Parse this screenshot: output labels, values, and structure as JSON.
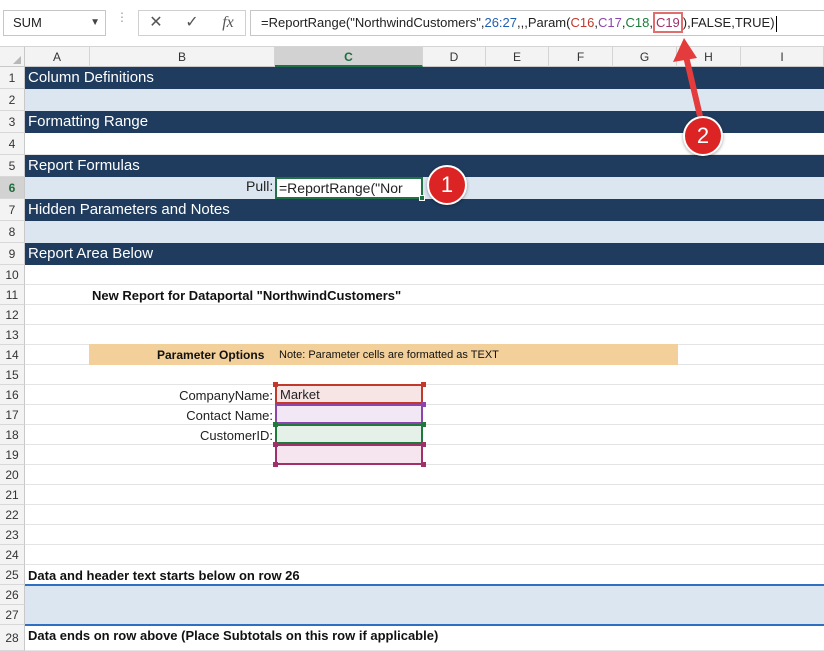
{
  "formula_bar": {
    "name_box": "SUM",
    "cancel_icon": "✕",
    "enter_icon": "✓",
    "fx_label": "fx",
    "formula_parts": [
      {
        "text": "=ReportRange(\"NorthwindCustomers\",",
        "color": "default"
      },
      {
        "text": "26:27",
        "color": "blue"
      },
      {
        "text": ",,,Param(",
        "color": "default"
      },
      {
        "text": "C16",
        "color": "red"
      },
      {
        "text": ",",
        "color": "default"
      },
      {
        "text": "C17",
        "color": "purple"
      },
      {
        "text": ",",
        "color": "default"
      },
      {
        "text": "C18",
        "color": "green"
      },
      {
        "text": ",",
        "color": "default"
      },
      {
        "text": "C19",
        "color": "magenta",
        "boxed": true
      },
      {
        "text": "),FALSE,TRUE)",
        "color": "default"
      }
    ]
  },
  "columns": {
    "labels": [
      "A",
      "B",
      "C",
      "D",
      "E",
      "F",
      "G",
      "H",
      "I"
    ],
    "selected": "C"
  },
  "rows": {
    "labels": [
      "1",
      "2",
      "3",
      "4",
      "5",
      "6",
      "7",
      "8",
      "9",
      "10",
      "11",
      "12",
      "13",
      "14",
      "15",
      "16",
      "17",
      "18",
      "19",
      "20",
      "21",
      "22",
      "23",
      "24",
      "25",
      "26",
      "27",
      "28"
    ],
    "selected": "6"
  },
  "sections": {
    "row1": "Column Definitions",
    "row3": "Formatting Range",
    "row5": "Report Formulas",
    "row7": "Hidden Parameters and Notes",
    "row9": "Report Area Below"
  },
  "pull": {
    "label": "Pull:",
    "cell_text": "=ReportRange(\"Nor"
  },
  "annotations": {
    "badge1": "1",
    "badge2": "2",
    "badge_color": "#dc2424"
  },
  "report": {
    "title": "New Report for Dataportal \"NorthwindCustomers\"",
    "param_title": "Parameter Options",
    "param_note": "Note: Parameter cells are formatted as TEXT",
    "labels": [
      "CompanyName:",
      "Contact Name:",
      "CustomerID:"
    ],
    "company_value": "Market",
    "row25": "Data and header text starts below on row 26",
    "row28": "Data ends on row above (Place Subtotals on this row if applicable)"
  },
  "colors": {
    "section_band": "#1f3c5e",
    "light_band": "#dce6f1",
    "param_bar": "#f3d09a",
    "excel_green": "#217346",
    "ref_red": "#c0392b",
    "ref_purple": "#8e44ad",
    "ref_green": "#1e7a3a",
    "ref_magenta": "#a0306a"
  }
}
